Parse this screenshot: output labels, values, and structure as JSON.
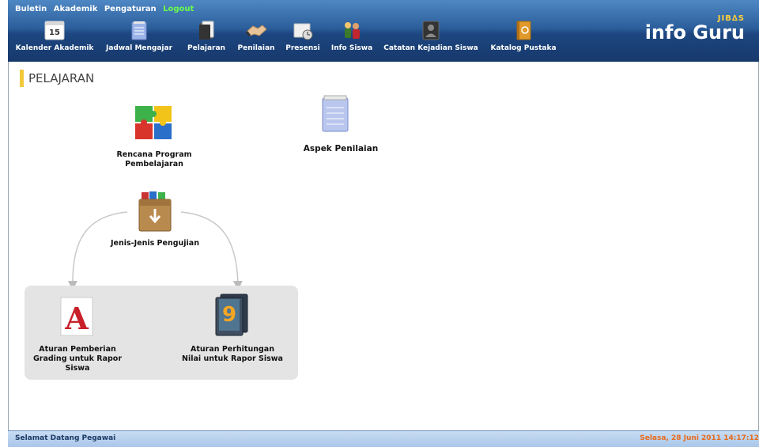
{
  "topmenu": {
    "buletin": "Buletin",
    "akademik": "Akademik",
    "pengaturan": "Pengaturan",
    "logout": "Logout"
  },
  "nav": {
    "items": [
      {
        "label": "Kalender Akademik",
        "icon": "calendar-icon",
        "day": "15"
      },
      {
        "label": "Jadwal Mengajar",
        "icon": "notepad-icon"
      },
      {
        "label": "Pelajaran",
        "icon": "books-icon"
      },
      {
        "label": "Penilaian",
        "icon": "handshake-icon"
      },
      {
        "label": "Presensi",
        "icon": "clock-icon"
      },
      {
        "label": "Info Siswa",
        "icon": "people-icon"
      },
      {
        "label": "Catatan Kejadian Siswa",
        "icon": "person-dark-icon"
      },
      {
        "label": "Katalog Pustaka",
        "icon": "book-catalog-icon"
      }
    ]
  },
  "brand": {
    "jibas": "JIB∆S",
    "name": "info Guru"
  },
  "page": {
    "title": "PELAJARAN"
  },
  "items": {
    "rencana": "Rencana Program Pembelajaran",
    "aspek": "Aspek Penilaian",
    "jenis": "Jenis-Jenis Pengujian",
    "grading": "Aturan Pemberian Grading untuk Rapor Siswa",
    "perhitungan": "Aturan Perhitungan Nilai untuk Rapor Siswa",
    "grading_letter": "A",
    "perhitungan_digit": "9"
  },
  "colors": {
    "header_top": "#4e88c4",
    "header_bottom": "#17396c",
    "logout": "#6cff4a",
    "accent_bar": "#f2c93b",
    "footer_date": "#e86b1d"
  },
  "footer": {
    "welcome": "Selamat Datang Pegawai",
    "datetime": "Selasa, 28 Juni 2011 14:17:12"
  }
}
